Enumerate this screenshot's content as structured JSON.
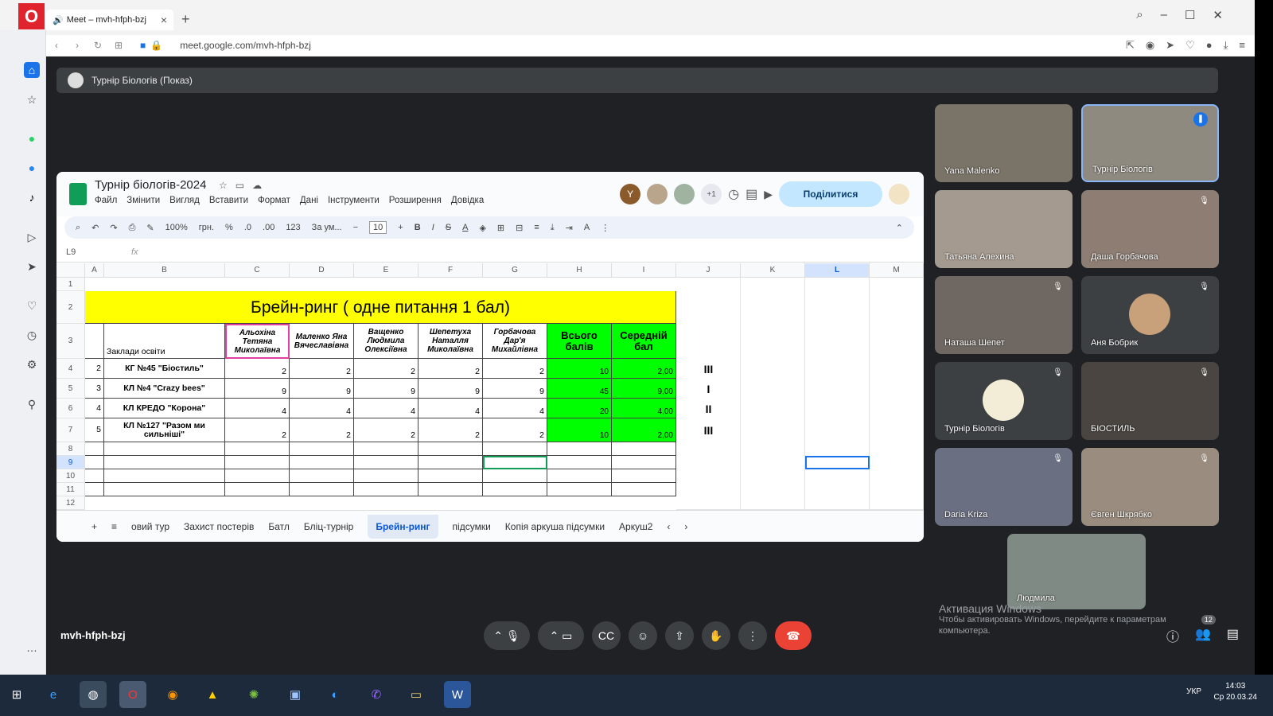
{
  "browser": {
    "tab_title": "Meet – mvh-hfph-bzj",
    "url": "meet.google.com/mvh-hfph-bzj",
    "window_controls": [
      "search-icon",
      "minimize-icon",
      "maximize-icon",
      "close-icon"
    ]
  },
  "meet": {
    "presenting_banner": "Турнір Біологів (Показ)",
    "meeting_code": "mvh-hfph-bzj",
    "participant_count": "12",
    "activation_title": "Активация Windows",
    "activation_text": "Чтобы активировать Windows, перейдите к параметрам компьютера.",
    "participants": [
      {
        "name": "Yana Malenko"
      },
      {
        "name": "Турнір Біологів"
      },
      {
        "name": "Татьяна Алехина"
      },
      {
        "name": "Даша Горбачова"
      },
      {
        "name": "Наташа Шепет"
      },
      {
        "name": "Аня Бобрик"
      },
      {
        "name": "Турнір Біологів"
      },
      {
        "name": "БІОСТИЛЬ"
      },
      {
        "name": "Daria Kriza"
      },
      {
        "name": "Євген Шкрябко"
      },
      {
        "name": "Людмила"
      }
    ]
  },
  "sheet": {
    "doc_title": "Турнір біологів-2024",
    "menu": [
      "Файл",
      "Змінити",
      "Вигляд",
      "Вставити",
      "Формат",
      "Дані",
      "Інструменти",
      "Розширення",
      "Довідка"
    ],
    "share_label": "Поділитися",
    "avatar_more": "+1",
    "toolbar": {
      "zoom": "100%",
      "currency": "грн.",
      "percent": "%",
      "dec_less": ".0",
      "dec_more": ".00",
      "format_num": "123",
      "font": "За ум...",
      "font_size": "10"
    },
    "name_box": "L9",
    "fx": "fx",
    "columns": [
      "A",
      "B",
      "C",
      "D",
      "E",
      "F",
      "G",
      "H",
      "I",
      "J",
      "K",
      "L",
      "M"
    ],
    "rows": [
      "1",
      "2",
      "3",
      "4",
      "5",
      "6",
      "7",
      "8",
      "9",
      "10",
      "11",
      "12"
    ],
    "title_cell": "Брейн-ринг ( одне питання  1 бал)",
    "institutions_header": "Заклади освіти",
    "judges": [
      "Альохіна Тетяна Миколаївна",
      "Маленко Яна Вячеславівна",
      "Ващенко Людмила Олексіївна",
      "Шепетуха Наталля Миколаївна",
      "Горбачова Дар'я Михайлівна"
    ],
    "total_header": "Всього балів",
    "avg_header": "Середній бал",
    "teams": [
      {
        "n": "2",
        "name": "КГ №45 \"Біостиль\"",
        "scores": [
          "2",
          "2",
          "2",
          "2",
          "2"
        ],
        "total": "10",
        "avg": "2,00",
        "place": "III"
      },
      {
        "n": "3",
        "name": "КЛ №4 \"Crazy bees\"",
        "scores": [
          "9",
          "9",
          "9",
          "9",
          "9"
        ],
        "total": "45",
        "avg": "9,00",
        "place": "I"
      },
      {
        "n": "4",
        "name": "КЛ КРЕДО \"Корона\"",
        "scores": [
          "4",
          "4",
          "4",
          "4",
          "4"
        ],
        "total": "20",
        "avg": "4,00",
        "place": "II"
      },
      {
        "n": "5",
        "name": "КЛ №127 \"Разом ми сильніші\"",
        "scores": [
          "2",
          "2",
          "2",
          "2",
          "2"
        ],
        "total": "10",
        "avg": "2,00",
        "place": "III"
      }
    ],
    "tabs": [
      "овий тур",
      "Захист постерів",
      "Батл",
      "Бліц-турнір",
      "Брейн-ринг",
      "підсумки",
      "Копія аркуша підсумки",
      "Аркуш2"
    ],
    "active_tab": "Брейн-ринг"
  },
  "taskbar": {
    "lang": "УКР",
    "time": "14:03",
    "date": "Ср 20.03.24"
  },
  "colors": {
    "title_yellow": "#ffff00",
    "score_green": "#00ff00",
    "meet_bg": "#202124",
    "end_call": "#ea4335",
    "share_btn": "#c2e7ff"
  }
}
